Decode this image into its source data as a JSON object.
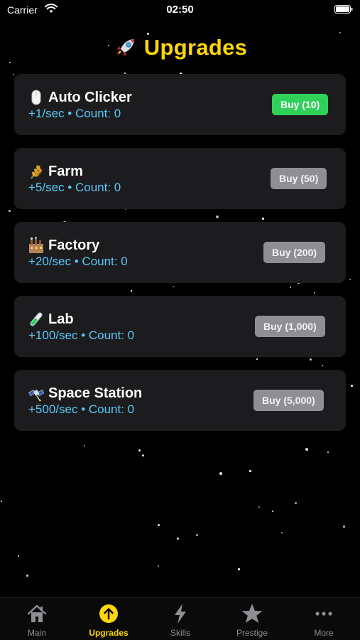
{
  "status_bar": {
    "carrier": "Carrier",
    "time": "02:50"
  },
  "header": {
    "title": "Upgrades",
    "icon": "rocket-icon",
    "title_color": "#ffd60a"
  },
  "upgrades": [
    {
      "name": "Auto Clicker",
      "icon": "mouse-icon",
      "stats": "+1/sec • Count: 0",
      "buy_label": "Buy (10)",
      "affordable": true
    },
    {
      "name": "Farm",
      "icon": "wheat-icon",
      "stats": "+5/sec • Count: 0",
      "buy_label": "Buy (50)",
      "affordable": false
    },
    {
      "name": "Factory",
      "icon": "factory-icon",
      "stats": "+20/sec • Count: 0",
      "buy_label": "Buy (200)",
      "affordable": false
    },
    {
      "name": "Lab",
      "icon": "test-tube-icon",
      "stats": "+100/sec • Count: 0",
      "buy_label": "Buy (1,000)",
      "affordable": false
    },
    {
      "name": "Space Station",
      "icon": "satellite-icon",
      "stats": "+500/sec • Count: 0",
      "buy_label": "Buy (5,000)",
      "affordable": false
    }
  ],
  "tabs": [
    {
      "label": "Main",
      "icon": "house-icon",
      "active": false
    },
    {
      "label": "Upgrades",
      "icon": "arrow-up-circle-icon",
      "active": true
    },
    {
      "label": "Skills",
      "icon": "bolt-icon",
      "active": false
    },
    {
      "label": "Prestige",
      "icon": "star-icon",
      "active": false
    },
    {
      "label": "More",
      "icon": "ellipsis-icon",
      "active": false
    }
  ],
  "colors": {
    "accent": "#ffd60a",
    "stat_text": "#5ac8fa",
    "buy_enabled": "#30d158",
    "buy_disabled": "#8e8e93",
    "card_bg": "#1c1c1e"
  }
}
